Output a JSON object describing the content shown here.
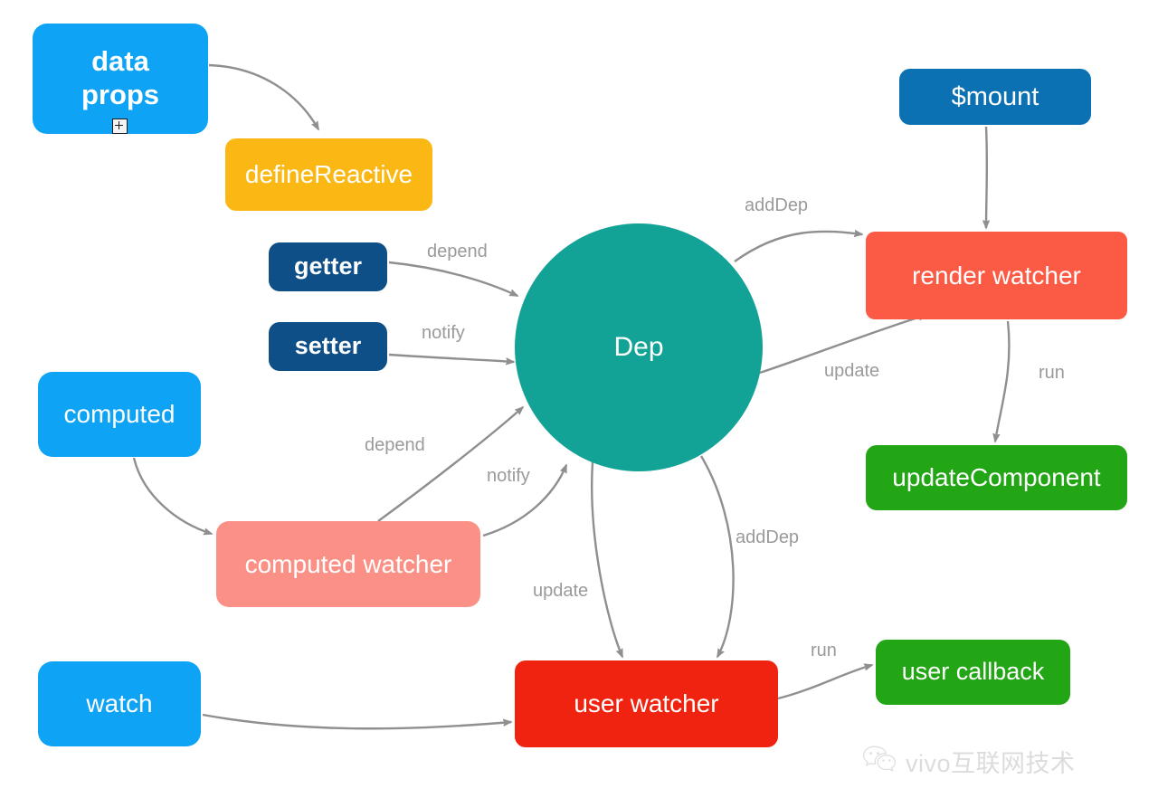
{
  "diagram": {
    "title": "Vue reactivity: Dep and Watcher relationships",
    "background": "#ffffff",
    "edge_color": "#8f8f8f",
    "edge_label_color": "#9a9a9a"
  },
  "nodes": [
    {
      "id": "data-props",
      "label": "data\nprops",
      "color": "#0fa3f5",
      "text_color": "#ffffff",
      "shape": "rounded-rect"
    },
    {
      "id": "definereactive",
      "label": "defineReactive",
      "color": "#fbb713",
      "text_color": "#ffffff",
      "shape": "rounded-rect"
    },
    {
      "id": "getter",
      "label": "getter",
      "color": "#0d4f86",
      "text_color": "#ffffff",
      "shape": "rounded-rect"
    },
    {
      "id": "setter",
      "label": "setter",
      "color": "#0d4f86",
      "text_color": "#ffffff",
      "shape": "rounded-rect"
    },
    {
      "id": "computed",
      "label": "computed",
      "color": "#0fa3f5",
      "text_color": "#ffffff",
      "shape": "rounded-rect"
    },
    {
      "id": "computed-watcher",
      "label": "computed watcher",
      "color": "#fb9086",
      "text_color": "#ffffff",
      "shape": "rounded-rect"
    },
    {
      "id": "watch",
      "label": "watch",
      "color": "#0fa3f5",
      "text_color": "#ffffff",
      "shape": "rounded-rect"
    },
    {
      "id": "dep",
      "label": "Dep",
      "color": "#12a396",
      "text_color": "#ffffff",
      "shape": "circle"
    },
    {
      "id": "mount",
      "label": "$mount",
      "color": "#0b71b3",
      "text_color": "#ffffff",
      "shape": "rounded-rect"
    },
    {
      "id": "render-watcher",
      "label": "render watcher",
      "color": "#fb5a45",
      "text_color": "#ffffff",
      "shape": "rounded-rect"
    },
    {
      "id": "updatecomponent",
      "label": "updateComponent",
      "color": "#22a615",
      "text_color": "#ffffff",
      "shape": "rounded-rect"
    },
    {
      "id": "user-watcher",
      "label": "user watcher",
      "color": "#f02311",
      "text_color": "#ffffff",
      "shape": "rounded-rect"
    },
    {
      "id": "user-callback",
      "label": "user callback",
      "color": "#22a615",
      "text_color": "#ffffff",
      "shape": "rounded-rect"
    }
  ],
  "edges": [
    {
      "id": "data-props-to-definereactive",
      "from": "data-props",
      "to": "definereactive",
      "label": ""
    },
    {
      "id": "getter-to-dep",
      "from": "getter",
      "to": "dep",
      "label": "depend"
    },
    {
      "id": "setter-to-dep",
      "from": "setter",
      "to": "dep",
      "label": "notify"
    },
    {
      "id": "computed-to-computed-watcher",
      "from": "computed",
      "to": "computed-watcher",
      "label": ""
    },
    {
      "id": "computed-watcher-to-dep-depend",
      "from": "computed-watcher",
      "to": "dep",
      "label": "depend"
    },
    {
      "id": "computed-watcher-to-dep-notify",
      "from": "computed-watcher",
      "to": "dep",
      "label": "notify"
    },
    {
      "id": "watch-to-user-watcher",
      "from": "watch",
      "to": "user-watcher",
      "label": ""
    },
    {
      "id": "dep-to-render-watcher-adddep",
      "from": "dep",
      "to": "render-watcher",
      "label": "addDep"
    },
    {
      "id": "dep-to-render-watcher-update",
      "from": "dep",
      "to": "render-watcher",
      "label": "update"
    },
    {
      "id": "mount-to-render-watcher",
      "from": "mount",
      "to": "render-watcher",
      "label": ""
    },
    {
      "id": "render-watcher-to-updatecomponent",
      "from": "render-watcher",
      "to": "updatecomponent",
      "label": "run"
    },
    {
      "id": "dep-to-user-watcher-update",
      "from": "dep",
      "to": "user-watcher",
      "label": "update"
    },
    {
      "id": "dep-to-user-watcher-adddep",
      "from": "dep",
      "to": "user-watcher",
      "label": "addDep"
    },
    {
      "id": "user-watcher-to-user-callback",
      "from": "user-watcher",
      "to": "user-callback",
      "label": "run"
    }
  ],
  "edge_labels": {
    "depend_getter": "depend",
    "notify_setter": "notify",
    "adddep_render": "addDep",
    "update_render": "update",
    "run_render": "run",
    "depend_computed": "depend",
    "notify_computed": "notify",
    "update_user": "update",
    "adddep_user": "addDep",
    "run_user": "run"
  },
  "overlay": {
    "cursor_icon": "plus-cursor-icon",
    "watermark_text": "vivo互联网技术",
    "watermark_icon": "wechat-icon"
  }
}
